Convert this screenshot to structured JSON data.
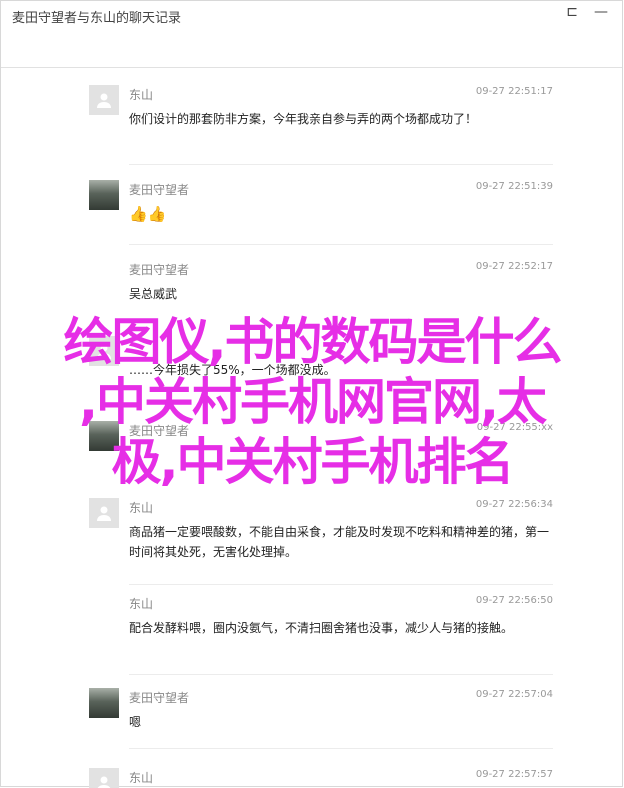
{
  "window": {
    "title": "麦田守望者与东山的聊天记录",
    "controls": [
      "⊏",
      "—"
    ]
  },
  "messages": [
    {
      "sender": "东山",
      "time": "09-27 22:51:17",
      "text": "你们设计的那套防非方案，今年我亲自参与弄的两个场都成功了！",
      "avatar": "default"
    },
    {
      "sender": "麦田守望者",
      "time": "09-27 22:51:39",
      "text": "👍👍",
      "avatar": "photo"
    },
    {
      "sender": "麦田守望者",
      "time": "09-27 22:52:17",
      "text": "吴总威武",
      "avatar": "none"
    },
    {
      "sender": "东山",
      "time": "09-27 22:55:2x",
      "text": "……今年损失了55%，一个场都没成。",
      "avatar": "default"
    },
    {
      "sender": "麦田守望者",
      "time": "09-27 22:55:xx",
      "text": "",
      "avatar": "photo"
    },
    {
      "sender": "东山",
      "time": "09-27 22:56:34",
      "text": "商品猪一定要喂酸数，不能自由采食，才能及时发现不吃料和精神差的猪，第一时间将其处死，无害化处理掉。",
      "avatar": "default"
    },
    {
      "sender": "东山",
      "time": "09-27 22:56:50",
      "text": "配合发酵料喂，圈内没氨气，不清扫圈舍猪也没事，减少人与猪的接触。",
      "avatar": "default"
    },
    {
      "sender": "麦田守望者",
      "time": "09-27 22:57:04",
      "text": "嗯",
      "avatar": "photo"
    },
    {
      "sender": "东山",
      "time": "09-27 22:57:57",
      "text": "",
      "avatar": "default"
    }
  ],
  "overlay": {
    "lines": [
      "绘图仪,书的数码是什么",
      ",中关村手机网官网,太",
      "极,中关村手机排名"
    ]
  }
}
